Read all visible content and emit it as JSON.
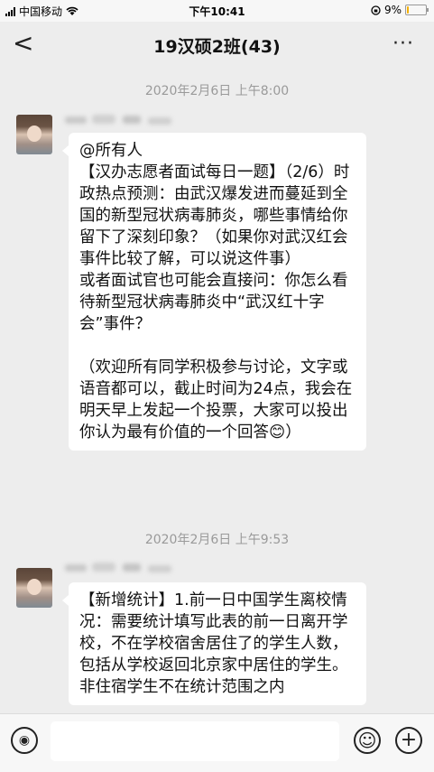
{
  "status_bar": {
    "carrier": "中国移动",
    "time": "下午10:41",
    "battery": "9%",
    "battery_level": 0.09
  },
  "nav": {
    "back_icon": "chevron-left-icon",
    "back_glyph": "<",
    "title": "19汉硕2班(43)",
    "more_icon": "more-icon",
    "more_glyph": "···"
  },
  "messages": [
    {
      "timestamp": "2020年2月6日 上午8:00",
      "text": "@所有人\n【汉办志愿者面试每日一题】（2/6）时政热点预测：由武汉爆发进而蔓延到全国的新型冠状病毒肺炎，哪些事情给你留下了深刻印象？（如果你对武汉红会事件比较了解，可以说这件事）\n或者面试官也可能会直接问：你怎么看待新型冠状病毒肺炎中“武汉红十字会”事件？\n\n（欢迎所有同学积极参与讨论，文字或语音都可以，截止时间为24点，我会在明天早上发起一个投票，大家可以投出你认为最有价值的一个回答😊）"
    },
    {
      "timestamp": "2020年2月6日 上午9:53",
      "text": "【新增统计】1.前一日中国学生离校情况：需要统计填写此表的前一日离开学校，不在学校宿舍居住了的学生人数，包括从学校返回北京家中居住的学生。非住宿学生不在统计范围之内"
    }
  ],
  "input_bar": {
    "voice_icon": "voice-icon",
    "voice_glyph": "◉",
    "emoji_icon": "emoji-icon",
    "emoji_glyph": "☺",
    "plus_icon": "plus-icon",
    "plus_glyph": "+"
  }
}
